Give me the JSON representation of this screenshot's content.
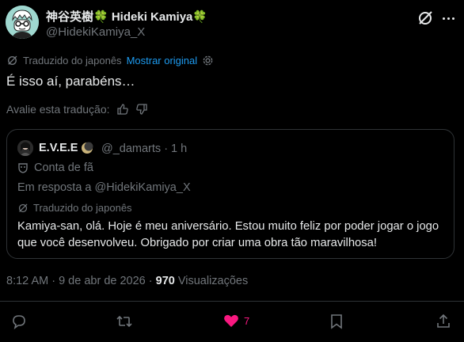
{
  "author": {
    "name": "神谷英樹🍀 Hideki Kamiya🍀",
    "handle": "@HidekiKamiya_X"
  },
  "translation": {
    "label": "Traduzido do japonês",
    "show_original": "Mostrar original"
  },
  "tweet_text": "É isso aí, parabéns…",
  "rate_label": "Avalie esta tradução:",
  "quote": {
    "name": "E.V.E.E",
    "handle_time": "@_damarts · 1 h",
    "fan_label": "Conta de fã",
    "reply_to": "Em resposta a @HidekiKamiya_X",
    "translated_label": "Traduzido do japonês",
    "text": "Kamiya-san, olá. Hoje é meu aniversário. Estou muito feliz por poder jogar o jogo que você desenvolveu. Obrigado por criar uma obra tão maravilhosa!"
  },
  "meta": {
    "time": "8:12 AM · 9 de abr de 2026 · ",
    "views_count": "970",
    "views_label": " Visualizações"
  },
  "actions": {
    "likes": "7"
  },
  "colors": {
    "background": "#000000",
    "text": "#e7e9ea",
    "muted": "#71767b",
    "link": "#1d9bf0",
    "like": "#f91880",
    "border": "#2f3336"
  }
}
